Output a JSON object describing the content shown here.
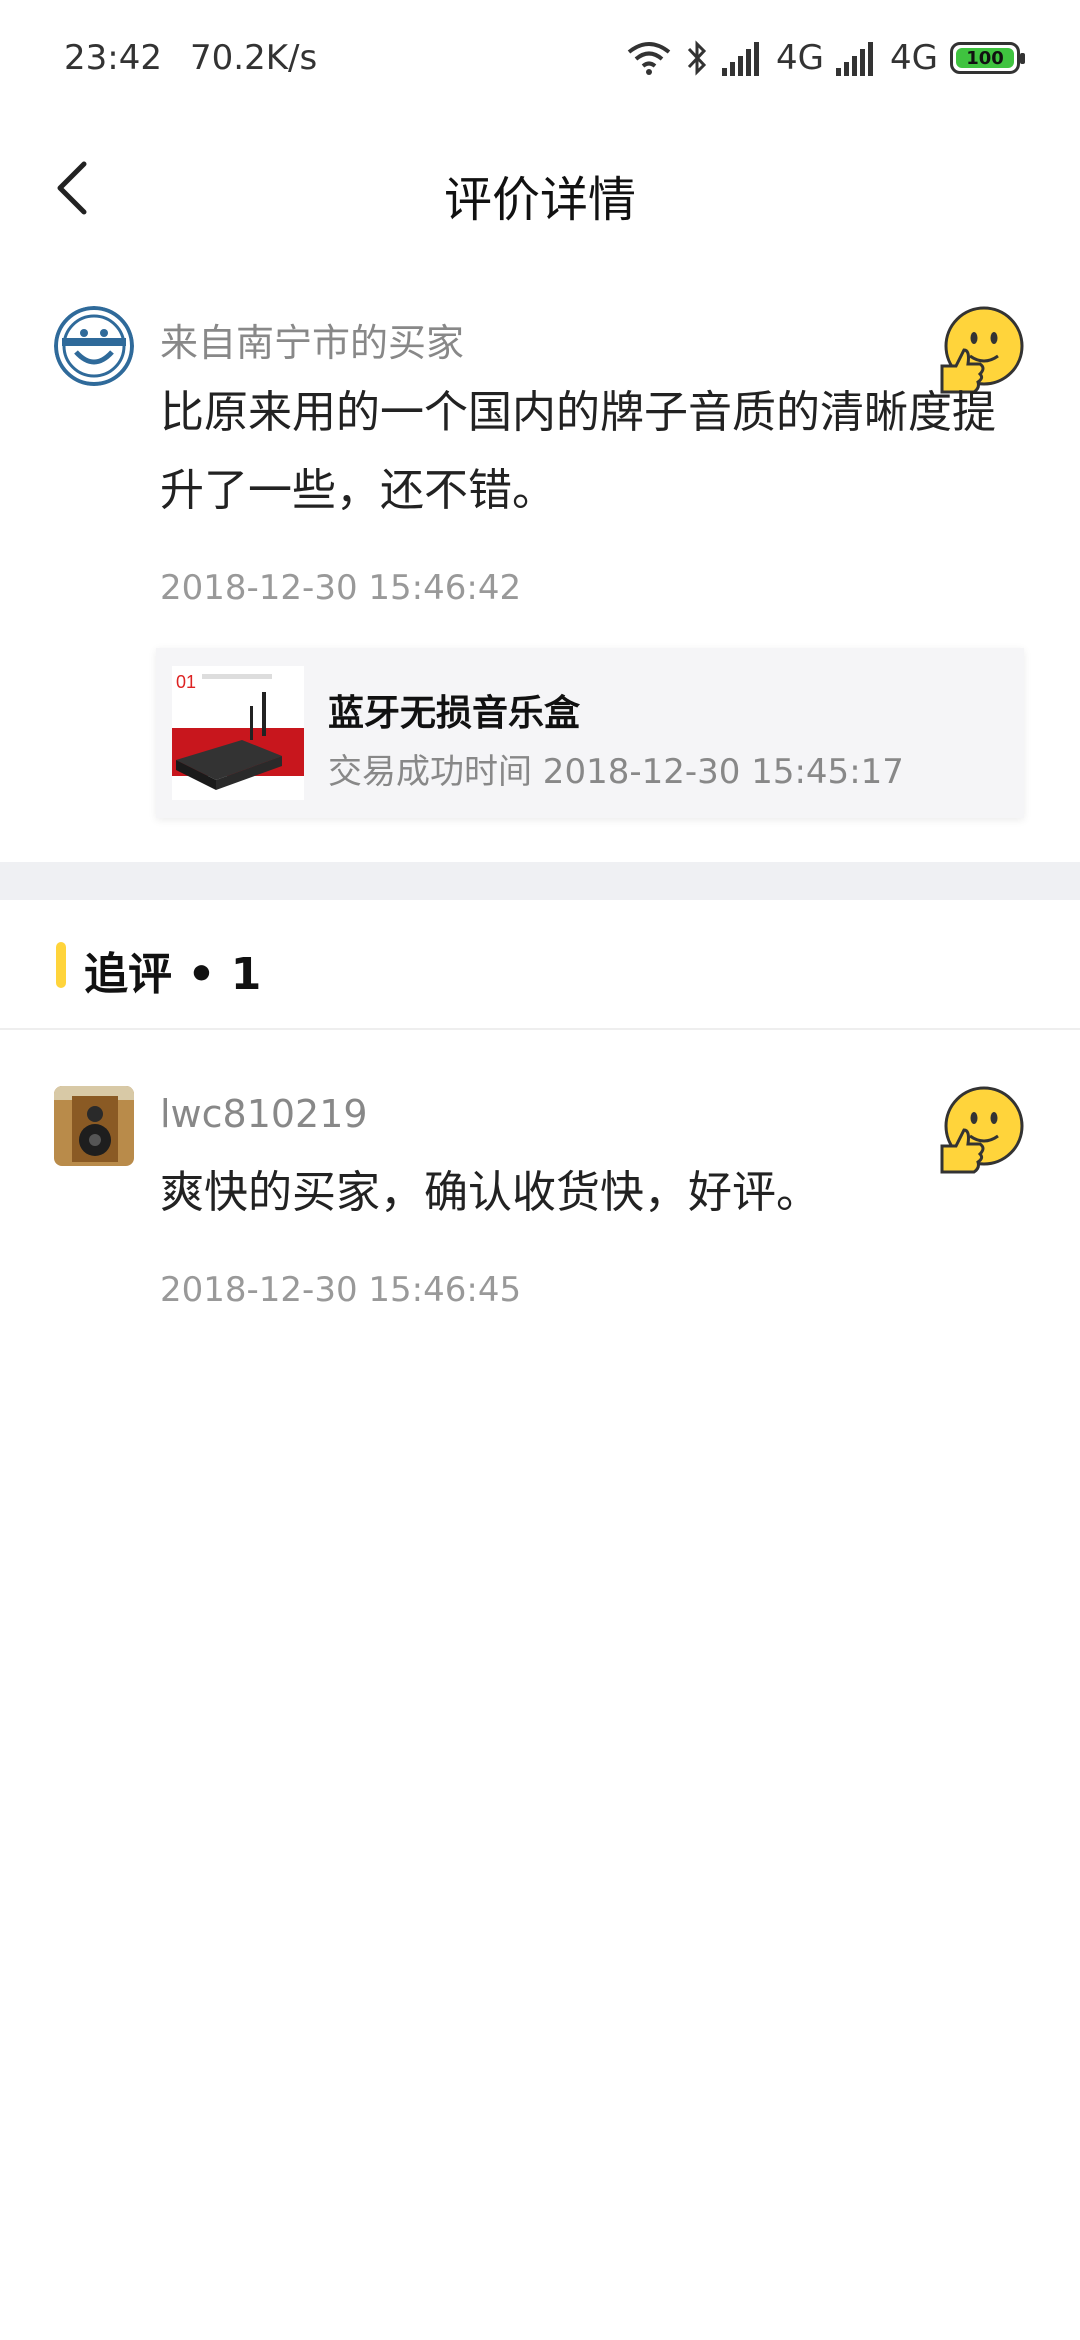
{
  "status_bar": {
    "time": "23:42",
    "speed": "70.2K/s",
    "network1": "4G",
    "network2": "4G",
    "battery": "100",
    "battery_color": "#3fc33f"
  },
  "header": {
    "title": "评价详情",
    "back_icon": "chevron-left-icon"
  },
  "review": {
    "reviewer": "来自南宁市的买家",
    "comment": "比原来用的一个国内的牌子音质的清晰度提升了一些，还不错。",
    "timestamp": "2018-12-30 15:46:42",
    "rating_icon": "thumbs-up-smiley-icon",
    "product": {
      "name": "蓝牙无损音乐盒",
      "trade_time": "交易成功时间 2018-12-30 15:45:17"
    }
  },
  "followup": {
    "title": "追评 • 1",
    "accent_color": "#ffd43b",
    "items": [
      {
        "reviewer": "lwc810219",
        "comment": "爽快的买家，确认收货快，好评。",
        "timestamp": "2018-12-30 15:46:45"
      }
    ]
  }
}
